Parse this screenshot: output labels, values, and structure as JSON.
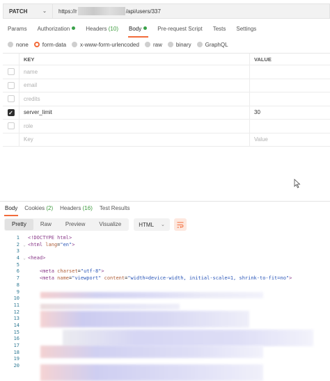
{
  "request": {
    "method": "PATCH",
    "url_prefix": "https://r",
    "url_suffix": "/api/users/337"
  },
  "request_tabs": [
    {
      "label": "Params",
      "count": "",
      "dot": false,
      "active": false
    },
    {
      "label": "Authorization",
      "count": "",
      "dot": true,
      "active": false
    },
    {
      "label": "Headers",
      "count": "(10)",
      "dot": false,
      "active": false
    },
    {
      "label": "Body",
      "count": "",
      "dot": true,
      "active": true
    },
    {
      "label": "Pre-request Script",
      "count": "",
      "dot": false,
      "active": false
    },
    {
      "label": "Tests",
      "count": "",
      "dot": false,
      "active": false
    },
    {
      "label": "Settings",
      "count": "",
      "dot": false,
      "active": false
    }
  ],
  "body_types": [
    {
      "label": "none",
      "selected": false
    },
    {
      "label": "form-data",
      "selected": true
    },
    {
      "label": "x-www-form-urlencoded",
      "selected": false
    },
    {
      "label": "raw",
      "selected": false
    },
    {
      "label": "binary",
      "selected": false
    },
    {
      "label": "GraphQL",
      "selected": false
    }
  ],
  "params_table": {
    "headers": {
      "key": "KEY",
      "value": "VALUE"
    },
    "rows": [
      {
        "key": "name",
        "value": "",
        "checked": false,
        "enabled": false
      },
      {
        "key": "email",
        "value": "",
        "checked": false,
        "enabled": false
      },
      {
        "key": "credits",
        "value": "",
        "checked": false,
        "enabled": false
      },
      {
        "key": "server_limit",
        "value": "30",
        "checked": true,
        "enabled": true
      },
      {
        "key": "role",
        "value": "",
        "checked": false,
        "enabled": false
      }
    ],
    "placeholder": {
      "key": "Key",
      "value": "Value"
    }
  },
  "response_tabs": [
    {
      "label": "Body",
      "count": "",
      "active": true
    },
    {
      "label": "Cookies",
      "count": "(2)",
      "active": false
    },
    {
      "label": "Headers",
      "count": "(16)",
      "active": false
    },
    {
      "label": "Test Results",
      "count": "",
      "active": false
    }
  ],
  "view_modes": [
    {
      "label": "Pretty",
      "active": true
    },
    {
      "label": "Raw",
      "active": false
    },
    {
      "label": "Preview",
      "active": false
    },
    {
      "label": "Visualize",
      "active": false
    }
  ],
  "language": "HTML",
  "code_lines": [
    {
      "n": "1",
      "arrow": "",
      "html": "<span class=\"tag\">&lt;!DOCTYPE html&gt;</span>"
    },
    {
      "n": "2",
      "arrow": "⌄",
      "html": "<span class=\"tag\">&lt;html</span> <span class=\"attr\">lang</span>=<span class=\"str\">\"en\"</span><span class=\"tag\">&gt;</span>"
    },
    {
      "n": "3",
      "arrow": "",
      "html": ""
    },
    {
      "n": "4",
      "arrow": "⌄",
      "html": "<span class=\"tag\">&lt;head&gt;</span>"
    },
    {
      "n": "5",
      "arrow": "",
      "html": ""
    },
    {
      "n": "6",
      "arrow": "",
      "html": "    <span class=\"tag\">&lt;meta</span> <span class=\"attr\">charset</span>=<span class=\"str\">\"utf-8\"</span><span class=\"tag\">&gt;</span>"
    },
    {
      "n": "7",
      "arrow": "",
      "html": "    <span class=\"tag\">&lt;meta</span> <span class=\"attr\">name</span>=<span class=\"str\">\"viewport\"</span> <span class=\"attr\">content</span>=<span class=\"str\">\"width=device-width, initial-scale=1, shrink-to-fit=no\"</span><span class=\"tag\">&gt;</span>"
    },
    {
      "n": "8",
      "arrow": "",
      "html": ""
    },
    {
      "n": "9",
      "arrow": "",
      "html": ""
    },
    {
      "n": "10",
      "arrow": "",
      "html": ""
    },
    {
      "n": "11",
      "arrow": "",
      "html": ""
    },
    {
      "n": "12",
      "arrow": "",
      "html": ""
    },
    {
      "n": "13",
      "arrow": "",
      "html": ""
    },
    {
      "n": "14",
      "arrow": "",
      "html": ""
    },
    {
      "n": "15",
      "arrow": "",
      "html": ""
    },
    {
      "n": "16",
      "arrow": "",
      "html": ""
    },
    {
      "n": "17",
      "arrow": "",
      "html": ""
    },
    {
      "n": "18",
      "arrow": "",
      "html": ""
    },
    {
      "n": "19",
      "arrow": "",
      "html": ""
    },
    {
      "n": "20",
      "arrow": "",
      "html": ""
    }
  ],
  "colors": {
    "accent": "#f26b3a",
    "status_green": "#3aa14a"
  }
}
